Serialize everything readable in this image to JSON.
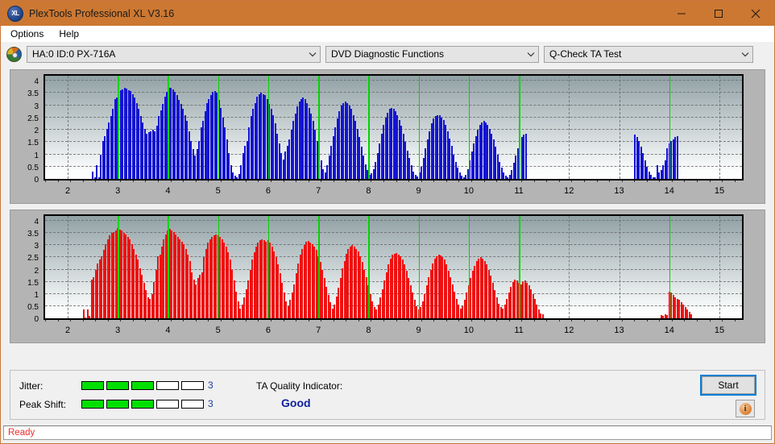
{
  "window": {
    "title": "PlexTools Professional XL V3.16",
    "app_icon": "xl-logo-icon",
    "icon_text": "XL",
    "minimize_label": "Minimize",
    "maximize_label": "Maximize",
    "close_label": "Close",
    "titlebar_color": "#cc7832"
  },
  "menu": {
    "items": [
      {
        "label": "Options"
      },
      {
        "label": "Help"
      }
    ]
  },
  "toolbar": {
    "drive_icon": "optical-disc-icon",
    "drive_select": {
      "value": "HA:0 ID:0  PX-716A"
    },
    "function_select": {
      "value": "DVD Diagnostic Functions"
    },
    "test_select": {
      "value": "Q-Check TA Test"
    }
  },
  "chart_data": [
    {
      "type": "bar",
      "title": "Jitter TA Test (upper plot)",
      "series_name": "Jitter",
      "color": "#1414d2",
      "xlabel": "",
      "ylabel": "",
      "xlim": [
        1.55,
        15.45
      ],
      "ylim": [
        0,
        4.2
      ],
      "yticks": [
        0,
        0.5,
        1,
        1.5,
        2,
        2.5,
        3,
        3.5,
        4
      ],
      "ytick_labels": [
        "0",
        "0.5",
        "1",
        "1.5",
        "2",
        "2.5",
        "3",
        "3.5",
        "4"
      ],
      "xticks": [
        2,
        3,
        4,
        5,
        6,
        7,
        8,
        9,
        10,
        11,
        12,
        13,
        14,
        15
      ],
      "xtick_labels": [
        "2",
        "3",
        "4",
        "5",
        "6",
        "7",
        "8",
        "9",
        "10",
        "11",
        "12",
        "13",
        "14",
        "15"
      ],
      "grid": true,
      "marker_lines": [
        3,
        4,
        5,
        6,
        7,
        8,
        9,
        10,
        11,
        14
      ],
      "marker_color": "#00d400",
      "x": [
        2.5,
        2.54,
        2.58,
        2.62,
        2.66,
        2.7,
        2.74,
        2.78,
        2.82,
        2.86,
        2.9,
        2.94,
        2.98,
        3.02,
        3.06,
        3.1,
        3.14,
        3.18,
        3.22,
        3.26,
        3.3,
        3.34,
        3.38,
        3.42,
        3.46,
        3.5,
        3.54,
        3.58,
        3.62,
        3.66,
        3.7,
        3.74,
        3.78,
        3.82,
        3.86,
        3.9,
        3.94,
        3.98,
        4.02,
        4.06,
        4.1,
        4.14,
        4.18,
        4.22,
        4.26,
        4.3,
        4.34,
        4.38,
        4.42,
        4.46,
        4.5,
        4.54,
        4.58,
        4.62,
        4.66,
        4.7,
        4.74,
        4.78,
        4.82,
        4.86,
        4.9,
        4.94,
        4.98,
        5.02,
        5.06,
        5.1,
        5.14,
        5.18,
        5.22,
        5.26,
        5.3,
        5.34,
        5.38,
        5.42,
        5.46,
        5.5,
        5.54,
        5.58,
        5.62,
        5.66,
        5.7,
        5.74,
        5.78,
        5.82,
        5.86,
        5.9,
        5.94,
        5.98,
        6.02,
        6.06,
        6.1,
        6.14,
        6.18,
        6.22,
        6.26,
        6.3,
        6.34,
        6.38,
        6.42,
        6.46,
        6.5,
        6.54,
        6.58,
        6.62,
        6.66,
        6.7,
        6.74,
        6.78,
        6.82,
        6.86,
        6.9,
        6.94,
        6.98,
        7.02,
        7.06,
        7.1,
        7.14,
        7.18,
        7.22,
        7.26,
        7.3,
        7.34,
        7.38,
        7.42,
        7.46,
        7.5,
        7.54,
        7.58,
        7.62,
        7.66,
        7.7,
        7.74,
        7.78,
        7.82,
        7.86,
        7.9,
        7.94,
        7.98,
        8.02,
        8.06,
        8.1,
        8.14,
        8.18,
        8.22,
        8.26,
        8.3,
        8.34,
        8.38,
        8.42,
        8.46,
        8.5,
        8.54,
        8.58,
        8.62,
        8.66,
        8.7,
        8.74,
        8.78,
        8.82,
        8.86,
        8.9,
        8.94,
        8.98,
        9.02,
        9.06,
        9.1,
        9.14,
        9.18,
        9.22,
        9.26,
        9.3,
        9.34,
        9.38,
        9.42,
        9.46,
        9.5,
        9.54,
        9.58,
        9.62,
        9.66,
        9.7,
        9.74,
        9.78,
        9.82,
        9.86,
        9.9,
        9.94,
        9.98,
        10.02,
        10.06,
        10.1,
        10.14,
        10.18,
        10.22,
        10.26,
        10.3,
        10.34,
        10.38,
        10.42,
        10.46,
        10.5,
        10.54,
        10.58,
        10.62,
        10.66,
        10.7,
        10.74,
        10.78,
        10.82,
        10.86,
        10.9,
        10.94,
        10.98,
        11.02,
        11.06,
        11.1,
        11.14,
        13.32,
        13.36,
        13.4,
        13.44,
        13.48,
        13.52,
        13.56,
        13.6,
        13.64,
        13.68,
        13.72,
        13.76,
        13.8,
        13.84,
        13.88,
        13.92,
        13.96,
        14.0,
        14.04,
        14.08,
        14.12,
        14.16
      ],
      "values": [
        0.3,
        0.08,
        0.55,
        0.08,
        1.0,
        1.55,
        1.75,
        2.05,
        2.3,
        2.55,
        2.85,
        3.25,
        3.3,
        3.55,
        3.6,
        3.65,
        3.7,
        3.68,
        3.62,
        3.58,
        3.45,
        3.3,
        3.1,
        2.85,
        2.55,
        2.3,
        2.05,
        1.85,
        1.9,
        1.95,
        2.0,
        1.95,
        2.15,
        2.55,
        2.8,
        3.05,
        3.35,
        3.55,
        3.7,
        3.72,
        3.65,
        3.55,
        3.4,
        3.2,
        3.05,
        2.85,
        2.6,
        2.35,
        1.95,
        1.55,
        1.2,
        0.95,
        1.2,
        1.55,
        2.1,
        2.35,
        2.75,
        3.1,
        3.25,
        3.4,
        3.55,
        3.58,
        3.5,
        3.2,
        2.9,
        2.5,
        2.1,
        1.6,
        1.05,
        0.55,
        0.25,
        0.12,
        0.05,
        0.2,
        0.55,
        1.05,
        1.35,
        1.55,
        2.1,
        2.55,
        2.85,
        3.1,
        3.35,
        3.45,
        3.5,
        3.45,
        3.4,
        3.25,
        3.05,
        2.85,
        2.6,
        2.25,
        1.85,
        1.45,
        1.05,
        0.8,
        1.1,
        1.35,
        1.6,
        2.0,
        2.35,
        2.65,
        2.95,
        3.15,
        3.25,
        3.3,
        3.25,
        3.1,
        2.9,
        2.65,
        2.35,
        2.0,
        1.55,
        1.15,
        0.75,
        0.4,
        0.25,
        0.55,
        0.95,
        1.35,
        1.75,
        2.1,
        2.45,
        2.75,
        3.0,
        3.1,
        3.15,
        3.08,
        3.0,
        2.85,
        2.6,
        2.35,
        2.05,
        1.7,
        1.3,
        0.95,
        0.6,
        0.35,
        0.18,
        0.22,
        0.4,
        0.7,
        1.05,
        1.45,
        1.85,
        2.2,
        2.5,
        2.7,
        2.85,
        2.9,
        2.85,
        2.75,
        2.6,
        2.4,
        2.15,
        1.85,
        1.5,
        1.15,
        0.85,
        0.55,
        0.3,
        0.15,
        0.1,
        0.25,
        0.5,
        0.85,
        1.25,
        1.6,
        1.95,
        2.25,
        2.45,
        2.55,
        2.6,
        2.58,
        2.5,
        2.4,
        2.2,
        1.95,
        1.65,
        1.35,
        1.0,
        0.7,
        0.45,
        0.25,
        0.12,
        0.08,
        0.18,
        0.4,
        0.75,
        1.1,
        1.45,
        1.75,
        2.0,
        2.2,
        2.3,
        2.35,
        2.3,
        2.2,
        2.05,
        1.85,
        1.6,
        1.3,
        1.0,
        0.7,
        0.45,
        0.25,
        0.12,
        0.08,
        0.15,
        0.35,
        0.65,
        0.95,
        1.25,
        1.5,
        1.7,
        1.8,
        1.85,
        1.8,
        1.7,
        1.55,
        1.3,
        1.05,
        0.75,
        0.5,
        0.3,
        0.15,
        0.08,
        0.05,
        0.55,
        0.25,
        0.35,
        0.55,
        0.75,
        1.25,
        1.45,
        1.55,
        1.6,
        1.7,
        1.75,
        1.8,
        1.85,
        1.82,
        1.75,
        1.68,
        1.55,
        1.4,
        1.1,
        0.85,
        0.55,
        0.25
      ]
    },
    {
      "type": "bar",
      "title": "Peak Shift TA Test (lower plot)",
      "series_name": "Peak Shift",
      "color": "#ef1010",
      "xlabel": "",
      "ylabel": "",
      "xlim": [
        1.55,
        15.45
      ],
      "ylim": [
        0,
        4.2
      ],
      "yticks": [
        0,
        0.5,
        1,
        1.5,
        2,
        2.5,
        3,
        3.5,
        4
      ],
      "ytick_labels": [
        "0",
        "0.5",
        "1",
        "1.5",
        "2",
        "2.5",
        "3",
        "3.5",
        "4"
      ],
      "xticks": [
        2,
        3,
        4,
        5,
        6,
        7,
        8,
        9,
        10,
        11,
        12,
        13,
        14,
        15
      ],
      "xtick_labels": [
        "2",
        "3",
        "4",
        "5",
        "6",
        "7",
        "8",
        "9",
        "10",
        "11",
        "12",
        "13",
        "14",
        "15"
      ],
      "grid": true,
      "marker_lines": [
        3,
        4,
        5,
        6,
        7,
        8,
        9,
        10,
        11,
        14
      ],
      "marker_color": "#00d400",
      "x": [
        2.32,
        2.36,
        2.4,
        2.44,
        2.48,
        2.52,
        2.56,
        2.6,
        2.64,
        2.68,
        2.72,
        2.76,
        2.8,
        2.84,
        2.88,
        2.92,
        2.96,
        3.0,
        3.04,
        3.08,
        3.12,
        3.16,
        3.2,
        3.24,
        3.28,
        3.32,
        3.36,
        3.4,
        3.44,
        3.48,
        3.52,
        3.56,
        3.6,
        3.64,
        3.68,
        3.72,
        3.76,
        3.8,
        3.84,
        3.88,
        3.92,
        3.96,
        4.0,
        4.04,
        4.08,
        4.12,
        4.16,
        4.2,
        4.24,
        4.28,
        4.32,
        4.36,
        4.4,
        4.44,
        4.48,
        4.52,
        4.56,
        4.6,
        4.64,
        4.68,
        4.72,
        4.76,
        4.8,
        4.84,
        4.88,
        4.92,
        4.96,
        5.0,
        5.04,
        5.08,
        5.12,
        5.16,
        5.2,
        5.24,
        5.28,
        5.32,
        5.36,
        5.4,
        5.44,
        5.48,
        5.52,
        5.56,
        5.6,
        5.64,
        5.68,
        5.72,
        5.76,
        5.8,
        5.84,
        5.88,
        5.92,
        5.96,
        6.0,
        6.04,
        6.08,
        6.12,
        6.16,
        6.2,
        6.24,
        6.28,
        6.32,
        6.36,
        6.4,
        6.44,
        6.48,
        6.52,
        6.56,
        6.6,
        6.64,
        6.68,
        6.72,
        6.76,
        6.8,
        6.84,
        6.88,
        6.92,
        6.96,
        7.0,
        7.04,
        7.08,
        7.12,
        7.16,
        7.2,
        7.24,
        7.28,
        7.32,
        7.36,
        7.4,
        7.44,
        7.48,
        7.52,
        7.56,
        7.6,
        7.64,
        7.68,
        7.72,
        7.76,
        7.8,
        7.84,
        7.88,
        7.92,
        7.96,
        8.0,
        8.04,
        8.08,
        8.12,
        8.16,
        8.2,
        8.24,
        8.28,
        8.32,
        8.36,
        8.4,
        8.44,
        8.48,
        8.52,
        8.56,
        8.6,
        8.64,
        8.68,
        8.72,
        8.76,
        8.8,
        8.84,
        8.88,
        8.92,
        8.96,
        9.0,
        9.04,
        9.08,
        9.12,
        9.16,
        9.2,
        9.24,
        9.28,
        9.32,
        9.36,
        9.4,
        9.44,
        9.48,
        9.52,
        9.56,
        9.6,
        9.64,
        9.68,
        9.72,
        9.76,
        9.8,
        9.84,
        9.88,
        9.92,
        9.96,
        10.0,
        10.04,
        10.08,
        10.12,
        10.16,
        10.2,
        10.24,
        10.28,
        10.32,
        10.36,
        10.4,
        10.44,
        10.48,
        10.52,
        10.56,
        10.6,
        10.64,
        10.68,
        10.72,
        10.76,
        10.8,
        10.84,
        10.88,
        10.92,
        10.96,
        11.0,
        11.04,
        11.08,
        11.12,
        11.16,
        11.2,
        11.24,
        11.28,
        11.32,
        11.36,
        11.4,
        11.44,
        11.48,
        13.84,
        13.88,
        13.92,
        13.96,
        14.0,
        14.04,
        14.08,
        14.12,
        14.16,
        14.2,
        14.24,
        14.28,
        14.32,
        14.36,
        14.4,
        14.44
      ],
      "values": [
        0.35,
        0.05,
        0.35,
        0.1,
        1.6,
        1.7,
        2.0,
        2.25,
        2.4,
        2.55,
        2.8,
        3.05,
        3.25,
        3.4,
        3.5,
        3.55,
        3.62,
        3.7,
        3.65,
        3.6,
        3.5,
        3.45,
        3.35,
        3.25,
        3.05,
        2.85,
        2.6,
        2.4,
        2.05,
        1.8,
        1.45,
        1.15,
        0.85,
        0.8,
        1.0,
        1.5,
        2.0,
        2.55,
        2.6,
        2.95,
        3.25,
        3.45,
        3.62,
        3.66,
        3.6,
        3.55,
        3.45,
        3.35,
        3.25,
        3.15,
        3.05,
        2.85,
        2.6,
        2.35,
        1.9,
        1.6,
        1.4,
        1.65,
        1.8,
        1.9,
        2.5,
        2.85,
        3.1,
        3.25,
        3.35,
        3.4,
        3.45,
        3.42,
        3.35,
        3.25,
        3.1,
        2.95,
        2.7,
        2.4,
        2.0,
        1.55,
        1.1,
        0.7,
        0.4,
        0.55,
        0.85,
        1.2,
        1.55,
        2.0,
        2.4,
        2.7,
        2.95,
        3.1,
        3.2,
        3.25,
        3.22,
        3.15,
        3.2,
        3.1,
        2.95,
        2.75,
        2.5,
        2.2,
        1.85,
        1.45,
        1.05,
        0.7,
        0.5,
        0.75,
        1.05,
        1.4,
        1.85,
        2.25,
        2.6,
        2.85,
        3.0,
        3.15,
        3.18,
        3.12,
        3.05,
        2.95,
        2.8,
        2.55,
        2.3,
        2.0,
        1.65,
        1.3,
        0.95,
        0.65,
        0.4,
        0.55,
        0.9,
        1.25,
        1.65,
        2.05,
        2.35,
        2.65,
        2.85,
        2.95,
        3.0,
        2.95,
        2.85,
        2.75,
        2.55,
        2.3,
        2.0,
        1.7,
        1.35,
        1.0,
        0.7,
        0.45,
        0.35,
        0.55,
        0.85,
        1.2,
        1.55,
        1.9,
        2.2,
        2.45,
        2.6,
        2.65,
        2.68,
        2.62,
        2.55,
        2.4,
        2.2,
        1.95,
        1.65,
        1.35,
        1.05,
        0.75,
        0.5,
        0.35,
        0.45,
        0.7,
        1.0,
        1.35,
        1.7,
        2.0,
        2.25,
        2.45,
        2.55,
        2.6,
        2.58,
        2.5,
        2.4,
        2.2,
        1.95,
        1.7,
        1.4,
        1.1,
        0.8,
        0.55,
        0.4,
        0.5,
        0.75,
        1.05,
        1.35,
        1.65,
        1.95,
        2.15,
        2.35,
        2.45,
        2.5,
        2.45,
        2.35,
        2.2,
        2.0,
        1.75,
        1.45,
        1.15,
        0.85,
        0.6,
        0.45,
        0.4,
        0.55,
        0.8,
        1.05,
        1.3,
        1.5,
        1.6,
        1.55,
        1.45,
        1.4,
        1.5,
        1.55,
        1.45,
        1.35,
        1.2,
        1.0,
        0.8,
        0.55,
        0.35,
        0.2,
        0.15,
        0.12,
        0.1,
        0.15,
        0.12,
        1.1,
        1.05,
        0.95,
        0.85,
        0.8,
        0.75,
        0.65,
        0.55,
        0.45,
        0.35,
        0.25,
        0.15
      ]
    }
  ],
  "indicators": {
    "jitter": {
      "label": "Jitter:",
      "segments_total": 5,
      "segments_filled": 3,
      "value": "3",
      "fill_color": "#00e000"
    },
    "peak_shift": {
      "label": "Peak Shift:",
      "segments_total": 5,
      "segments_filled": 3,
      "value": "3",
      "fill_color": "#00e000"
    },
    "quality": {
      "label": "TA Quality Indicator:",
      "value": "Good",
      "value_color": "#10219b"
    },
    "start_button": "Start",
    "info_button_icon": "info-icon"
  },
  "status": {
    "text": "Ready",
    "color": "#f22c2c"
  }
}
